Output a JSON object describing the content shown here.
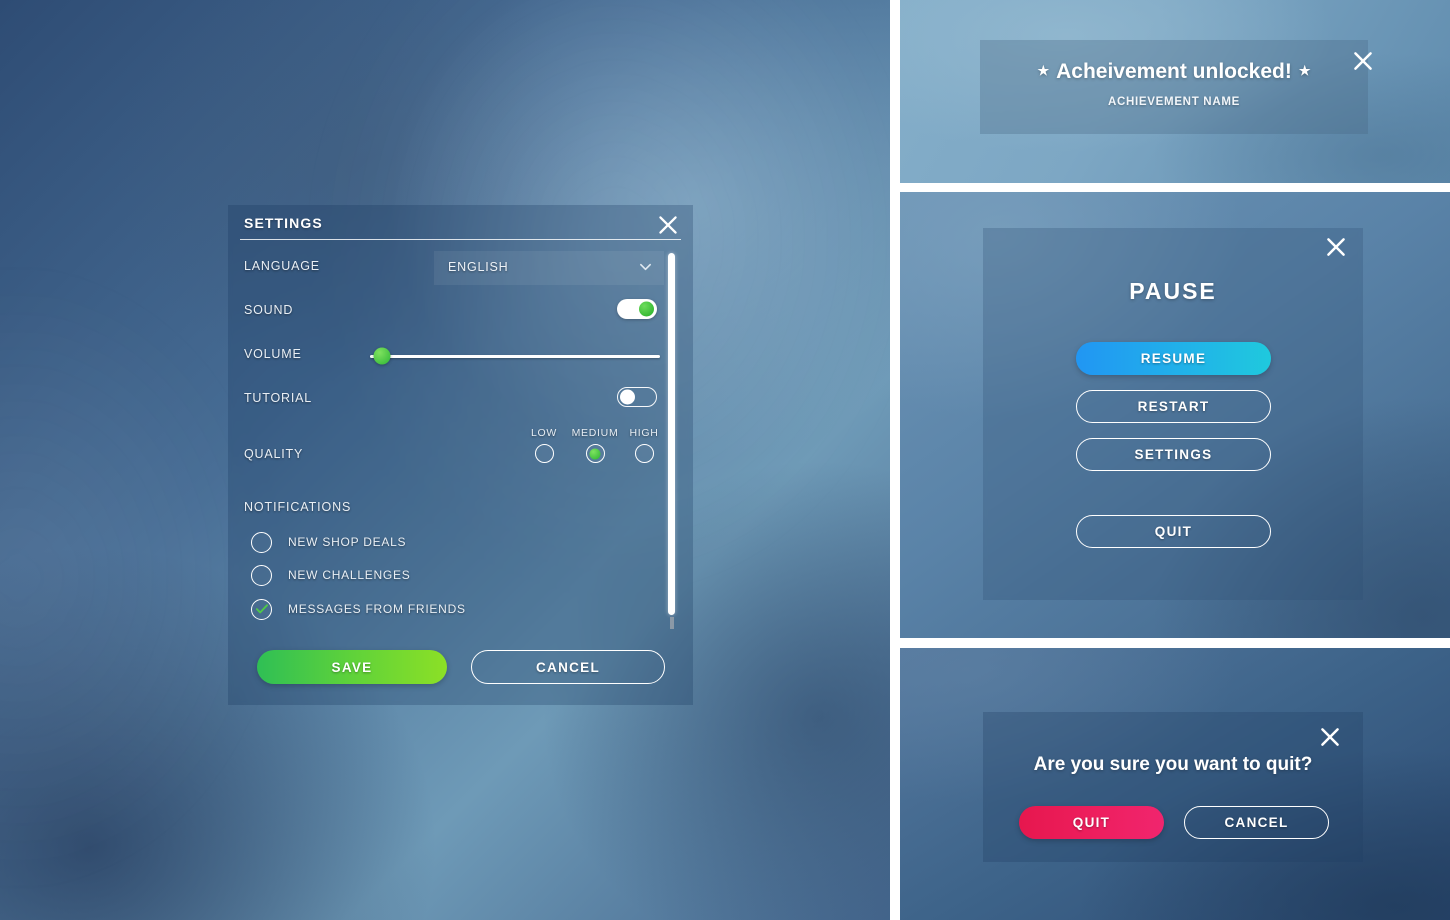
{
  "settings": {
    "title": "SETTINGS",
    "close_icon": "close-icon",
    "language": {
      "label": "LANGUAGE",
      "value": "ENGLISH",
      "chevron_icon": "chevron-down-icon",
      "options": [
        "ENGLISH"
      ]
    },
    "sound": {
      "label": "SOUND",
      "state": "on"
    },
    "volume": {
      "label": "VOLUME",
      "value": 4,
      "min": 0,
      "max": 100
    },
    "tutorial": {
      "label": "TUTORIAL",
      "state": "off"
    },
    "quality": {
      "label": "QUALITY",
      "options": [
        "LOW",
        "MEDIUM",
        "HIGH"
      ],
      "selected": "MEDIUM"
    },
    "notifications": {
      "label": "NOTIFICATIONS",
      "items": [
        {
          "label": "NEW SHOP DEALS",
          "checked": false
        },
        {
          "label": "NEW CHALLENGES",
          "checked": false
        },
        {
          "label": "MESSAGES FROM FRIENDS",
          "checked": true
        }
      ],
      "check_icon": "check-icon"
    },
    "actions": {
      "save_label": "SAVE",
      "cancel_label": "CANCEL"
    },
    "scrollbar": {
      "name": "vertical-scrollbar"
    }
  },
  "achievement": {
    "title": "Acheivement unlocked!",
    "star_glyph": "★",
    "subtitle": "ACHIEVEMENT NAME",
    "close_icon": "close-icon"
  },
  "pause": {
    "title": "PAUSE",
    "close_icon": "close-icon",
    "buttons": [
      {
        "label": "RESUME",
        "style": "primary"
      },
      {
        "label": "RESTART",
        "style": "outline"
      },
      {
        "label": "SETTINGS",
        "style": "outline"
      },
      {
        "label": "QUIT",
        "style": "outline"
      }
    ]
  },
  "quit_confirm": {
    "question": "Are you sure you want to quit?",
    "close_icon": "close-icon",
    "quit_label": "QUIT",
    "cancel_label": "CANCEL"
  },
  "colors": {
    "accent_green": "#5fd23a",
    "accent_blue": "#21b4e8",
    "accent_pink": "#ee1f5f",
    "text_light": "#ffffff",
    "panel_overlay": "rgba(24,54,90,0.25)"
  }
}
